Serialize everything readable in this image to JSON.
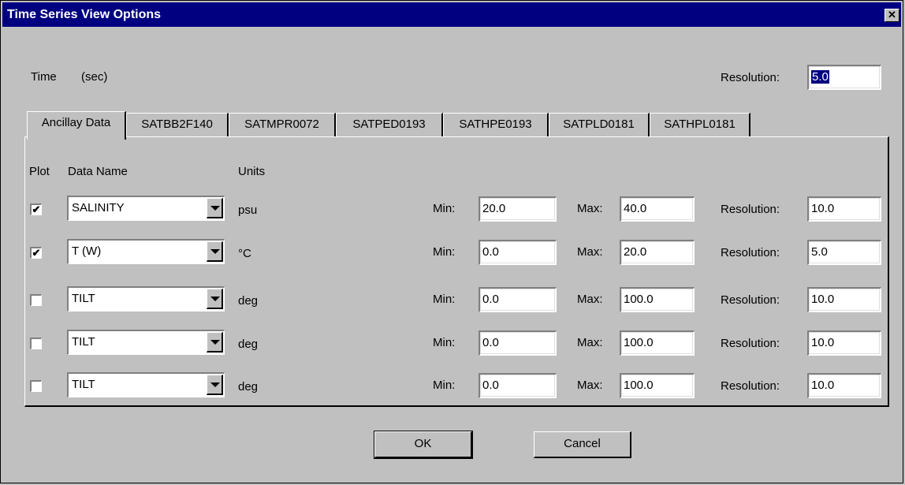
{
  "window": {
    "title": "Time Series View Options",
    "close_label": "✕"
  },
  "header": {
    "time_label": "Time",
    "time_unit": "(sec)",
    "resolution_label": "Resolution:",
    "resolution_value": "5.0"
  },
  "tabs": [
    "Ancillay Data",
    "SATBB2F140",
    "SATMPR0072",
    "SATPED0193",
    "SATHPE0193",
    "SATPLD0181",
    "SATHPL0181"
  ],
  "columns": {
    "plot": "Plot",
    "data_name": "Data Name",
    "units": "Units"
  },
  "row_labels": {
    "min": "Min:",
    "max": "Max:",
    "resolution": "Resolution:"
  },
  "rows": [
    {
      "checked": true,
      "check_glyph": "✔",
      "name": "SALINITY",
      "units": "psu",
      "min": "20.0",
      "max": "40.0",
      "resolution": "10.0"
    },
    {
      "checked": true,
      "check_glyph": "✔",
      "name": "T (W)",
      "units": "°C",
      "min": "0.0",
      "max": "20.0",
      "resolution": "5.0"
    },
    {
      "checked": false,
      "check_glyph": "",
      "name": "TILT",
      "units": "deg",
      "min": "0.0",
      "max": "100.0",
      "resolution": "10.0"
    },
    {
      "checked": false,
      "check_glyph": "",
      "name": "TILT",
      "units": "deg",
      "min": "0.0",
      "max": "100.0",
      "resolution": "10.0"
    },
    {
      "checked": false,
      "check_glyph": "",
      "name": "TILT",
      "units": "deg",
      "min": "0.0",
      "max": "100.0",
      "resolution": "10.0"
    }
  ],
  "buttons": {
    "ok": "OK",
    "cancel": "Cancel"
  }
}
